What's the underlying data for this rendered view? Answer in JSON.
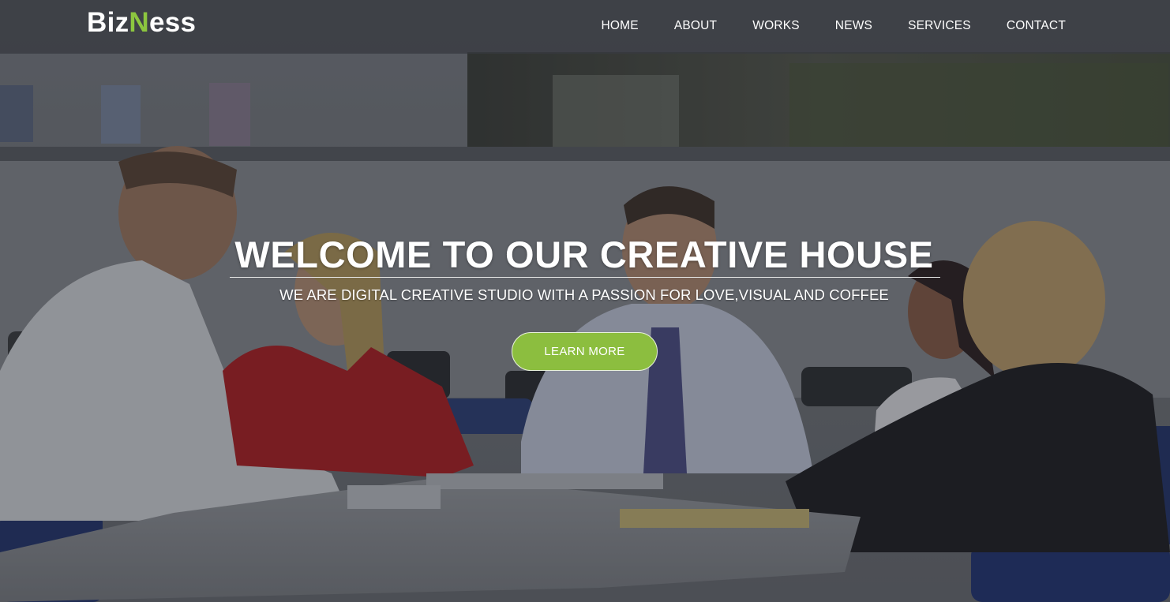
{
  "brand": {
    "logo_prefix": "Biz",
    "logo_accent": "N",
    "logo_suffix": "ess",
    "accent_color": "#8cc63f"
  },
  "nav": {
    "items": [
      {
        "label": "HOME"
      },
      {
        "label": "ABOUT"
      },
      {
        "label": "WORKS"
      },
      {
        "label": "NEWS"
      },
      {
        "label": "SERVICES"
      },
      {
        "label": "CONTACT"
      }
    ]
  },
  "hero": {
    "headline": "WELCOME TO OUR CREATIVE HOUSE",
    "tagline": "WE ARE DIGITAL CREATIVE STUDIO WITH A PASSION FOR LOVE,VISUAL AND COFFEE",
    "cta_label": "LEARN MORE",
    "cta_color": "#8cbe3f",
    "background_image": "office-meeting-photo"
  }
}
